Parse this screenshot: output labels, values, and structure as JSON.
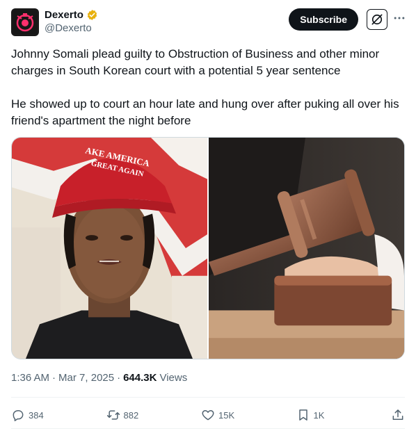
{
  "account": {
    "display_name": "Dexerto",
    "handle": "@Dexerto",
    "verified_color": "#e8b10e"
  },
  "header_actions": {
    "subscribe_label": "Subscribe",
    "grok_icon": "grok-icon",
    "more_icon": "more-icon"
  },
  "tweet": {
    "paragraph_1": "Johnny Somali plead guilty to Obstruction of Business and other minor charges in South Korean court with a potential 5 year sentence",
    "paragraph_2": "He showed up to court an hour late and hung over after puking all over his friend's apartment the night before"
  },
  "media": {
    "left_image": "photo-man-red-hat",
    "right_image": "photo-judge-gavel",
    "hat_text_1": "AKE AMERICA",
    "hat_text_2": "GREAT AGAIN"
  },
  "meta": {
    "time": "1:36 AM",
    "sep1": "·",
    "date": "Mar 7, 2025",
    "sep2": "·",
    "views_count": "644.3K",
    "views_label": "Views"
  },
  "actions": {
    "replies": "384",
    "reposts": "882",
    "likes": "15K",
    "bookmarks": "1K"
  },
  "colors": {
    "text": "#0f1419",
    "secondary": "#536471",
    "border": "#eff3f4"
  }
}
